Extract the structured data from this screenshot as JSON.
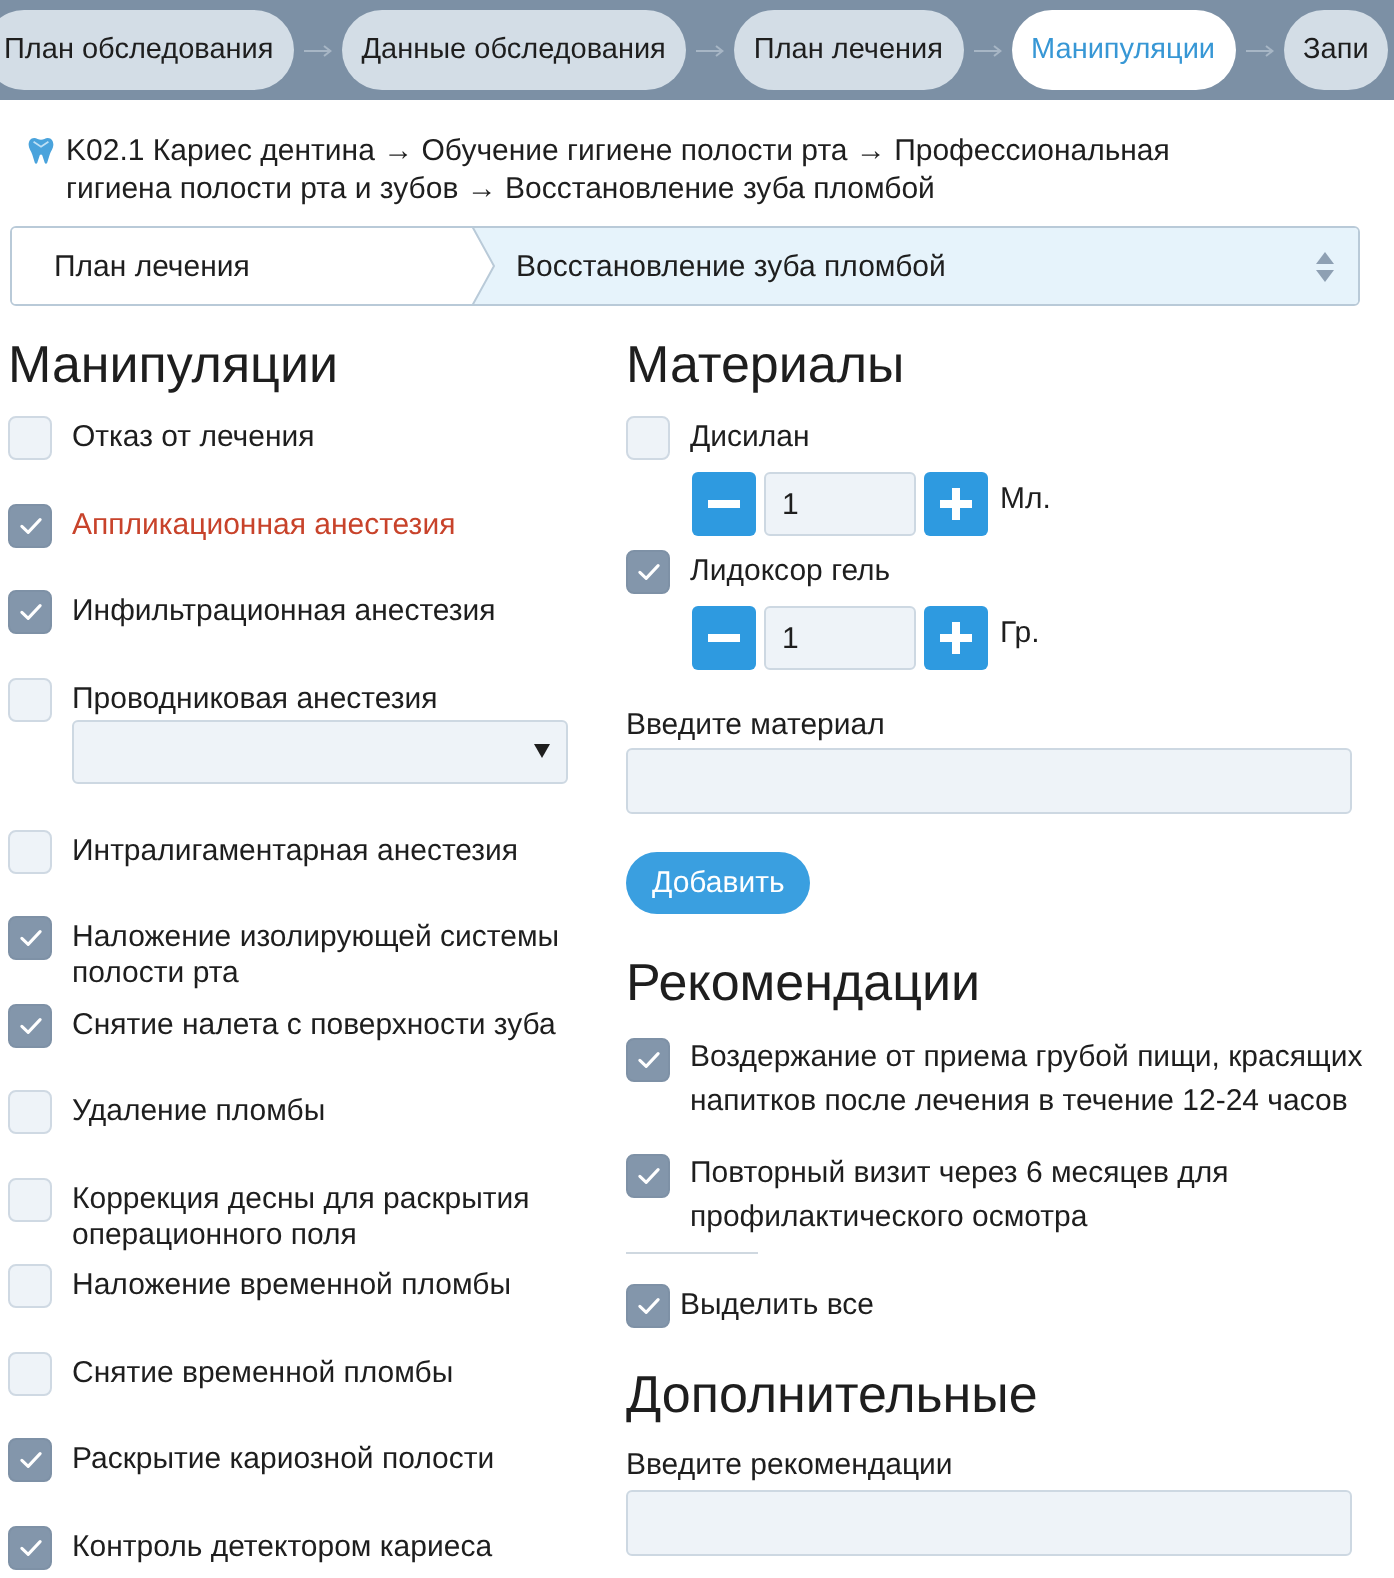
{
  "steps": [
    {
      "label": "План обследования",
      "selected": false
    },
    {
      "label": "Данные обследования",
      "selected": false
    },
    {
      "label": "План лечения",
      "selected": false
    },
    {
      "label": "Манипуляции",
      "selected": true
    },
    {
      "label": "Запи",
      "selected": false
    }
  ],
  "diagnosis_path": "K02.1 Кариес дентина → Обучение гигиене полости рта → Профессиональная гигиена полости рта и зубов → Восстановление зуба пломбой",
  "path_select": {
    "segment": "План лечения",
    "value": "Восстановление зуба пломбой"
  },
  "manipulations": {
    "title": "Манипуляции",
    "items": [
      {
        "kind": "checkbox",
        "label": "Отказ от лечения",
        "checked": false,
        "highlighted": false
      },
      {
        "kind": "checkbox",
        "label": "Аппликационная анестезия",
        "checked": true,
        "highlighted": true
      },
      {
        "kind": "checkbox",
        "label": "Инфильтрационная анестезия",
        "checked": true,
        "highlighted": false
      },
      {
        "kind": "select",
        "label": "Проводниковая анестезия",
        "checked": false,
        "highlighted": false
      },
      {
        "kind": "checkbox",
        "label": "Интралигаментарная анестезия",
        "checked": false,
        "highlighted": false
      },
      {
        "kind": "checkbox",
        "label": "Наложение изолирующей системы полости рта",
        "checked": true,
        "highlighted": false
      },
      {
        "kind": "checkbox",
        "label": "Снятие налета с поверхности зуба",
        "checked": true,
        "highlighted": false
      },
      {
        "kind": "checkbox",
        "label": "Удаление пломбы",
        "checked": false,
        "highlighted": false
      },
      {
        "kind": "checkbox",
        "label": "Коррекция десны для раскрытия операционного поля",
        "checked": false,
        "highlighted": false
      },
      {
        "kind": "checkbox",
        "label": "Наложение временной пломбы",
        "checked": false,
        "highlighted": false
      },
      {
        "kind": "checkbox",
        "label": "Снятие временной пломбы",
        "checked": false,
        "highlighted": false
      },
      {
        "kind": "checkbox",
        "label": "Раскрытие кариозной полости",
        "checked": true,
        "highlighted": false
      },
      {
        "kind": "checkbox",
        "label": "Контроль детектором кариеса",
        "checked": true,
        "highlighted": false
      }
    ]
  },
  "materials": {
    "title": "Материалы",
    "items": [
      {
        "label": "Дисилан",
        "checked": false,
        "quantity": "1",
        "unit": "Мл."
      },
      {
        "label": "Лидоксор гель",
        "checked": true,
        "quantity": "1",
        "unit": "Гр."
      }
    ],
    "input_label": "Введите материал",
    "add_button": "Добавить"
  },
  "recommendations": {
    "title": "Рекомендации",
    "items": [
      {
        "text": "Воздержание от приема грубой пищи, красящих напитков после лечения в течение 12-24 часов",
        "checked": true
      },
      {
        "text": "Повторный визит через 6 месяцев для профилактического осмотра",
        "checked": true
      }
    ],
    "select_all": {
      "label": "Выделить все",
      "checked": true
    }
  },
  "additional": {
    "title": "Дополнительные",
    "input_label": "Введите рекомендации"
  }
}
